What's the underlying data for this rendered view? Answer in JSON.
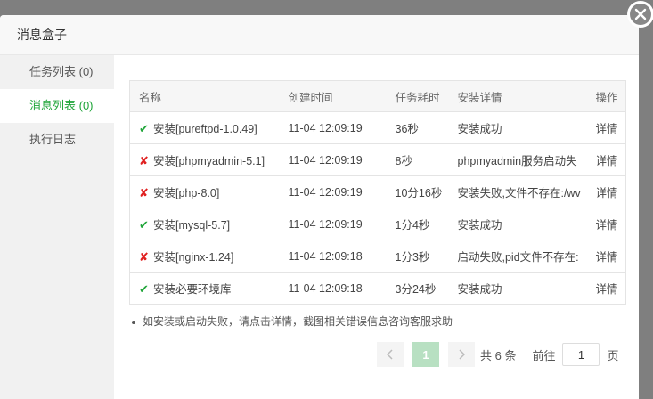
{
  "dialog": {
    "title": "消息盒子"
  },
  "sidebar": {
    "items": [
      {
        "label": "任务列表 (0)"
      },
      {
        "label": "消息列表 (0)"
      },
      {
        "label": "执行日志"
      }
    ]
  },
  "table": {
    "headers": [
      "名称",
      "创建时间",
      "任务耗时",
      "安装详情",
      "操作"
    ],
    "rows": [
      {
        "status": "success",
        "name": "安装[pureftpd-1.0.49]",
        "time": "11-04 12:09:19",
        "duration": "36秒",
        "detail": "安装成功",
        "action": "详情"
      },
      {
        "status": "fail",
        "name": "安装[phpmyadmin-5.1]",
        "time": "11-04 12:09:19",
        "duration": "8秒",
        "detail": "phpmyadmin服务启动失",
        "action": "详情"
      },
      {
        "status": "fail",
        "name": "安装[php-8.0]",
        "time": "11-04 12:09:19",
        "duration": "10分16秒",
        "detail": "安装失败,文件不存在:/wv",
        "action": "详情"
      },
      {
        "status": "success",
        "name": "安装[mysql-5.7]",
        "time": "11-04 12:09:19",
        "duration": "1分4秒",
        "detail": "安装成功",
        "action": "详情"
      },
      {
        "status": "fail",
        "name": "安装[nginx-1.24]",
        "time": "11-04 12:09:18",
        "duration": "1分3秒",
        "detail": "启动失败,pid文件不存在:",
        "action": "详情"
      },
      {
        "status": "success",
        "name": "安装必要环境库",
        "time": "11-04 12:09:18",
        "duration": "3分24秒",
        "detail": "安装成功",
        "action": "详情"
      }
    ]
  },
  "tip": "如安装或启动失败，请点击详情，截图相关错误信息咨询客服求助",
  "pager": {
    "current": "1",
    "total_text": "共 6 条",
    "goto_label": "前往",
    "goto_value": "1",
    "page_unit": "页"
  },
  "colors": {
    "success": "#20a53a",
    "fail": "#e02020"
  }
}
